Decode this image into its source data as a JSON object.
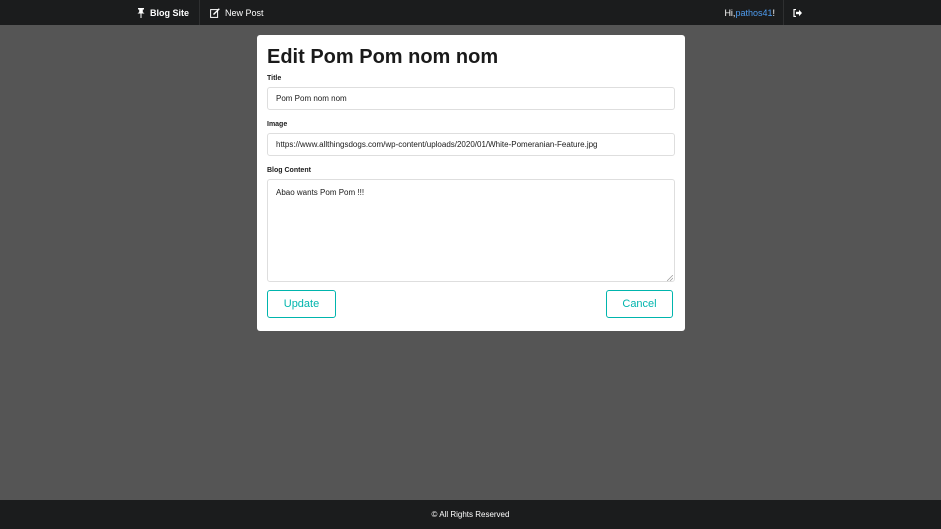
{
  "navbar": {
    "brand_label": "Blog Site",
    "brand_icon": "pin-icon",
    "new_post_label": "New Post",
    "new_post_icon": "edit-icon",
    "greeting_prefix": "Hi, ",
    "username": "pathos41",
    "greeting_suffix": "!",
    "logout_icon": "sign-out-icon"
  },
  "form": {
    "heading": "Edit Pom Pom nom nom",
    "title_label": "Title",
    "title_value": "Pom Pom nom nom",
    "image_label": "Image",
    "image_value": "https://www.allthingsdogs.com/wp-content/uploads/2020/01/White-Pomeranian-Feature.jpg",
    "content_label": "Blog Content",
    "content_value": "Abao wants Pom Pom !!!",
    "update_label": "Update",
    "cancel_label": "Cancel"
  },
  "footer": {
    "text": "© All Rights Reserved"
  },
  "colors": {
    "navbar_bg": "#1b1c1d",
    "page_bg": "#555555",
    "accent_teal": "#00b5ad",
    "username_blue": "#4e9cf0"
  }
}
